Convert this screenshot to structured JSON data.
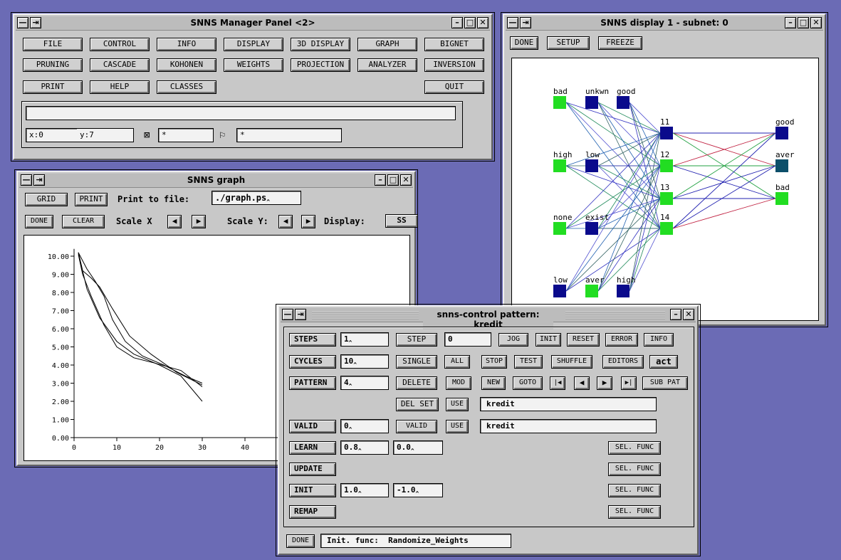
{
  "manager": {
    "title": "SNNS Manager Panel <2>",
    "row1": [
      "FILE",
      "CONTROL",
      "INFO",
      "DISPLAY",
      "3D DISPLAY",
      "GRAPH",
      "BIGNET"
    ],
    "row2": [
      "PRUNING",
      "CASCADE",
      "KOHONEN",
      "WEIGHTS",
      "PROJECTION",
      "ANALYZER",
      "INVERSION"
    ],
    "row3": [
      "PRINT",
      "HELP",
      "CLASSES"
    ],
    "quit": "QUIT",
    "message": "",
    "x_label": "x:0",
    "y_label": "y:7",
    "field1": "*",
    "field2": "*"
  },
  "display": {
    "title": "SNNS display 1 - subnet: 0",
    "buttons": [
      "DONE",
      "SETUP",
      "FREEZE"
    ],
    "unit_labels": [
      "bad",
      "unkwn",
      "good",
      "high",
      "low",
      "none",
      "exist",
      "low",
      "aver",
      "high",
      "11",
      "12",
      "13",
      "14",
      "good",
      "aver",
      "bad"
    ]
  },
  "graph": {
    "title": "SNNS graph",
    "grid": "GRID",
    "print": "PRINT",
    "print_to_file": "Print to file:",
    "file": "./graph.ps",
    "done": "DONE",
    "clear": "CLEAR",
    "scale_x": "Scale X",
    "scale_y": "Scale Y:",
    "display": "Display:",
    "ss": "SS",
    "y_ticks": [
      "10.00",
      "9.00",
      "8.00",
      "7.00",
      "6.00",
      "5.00",
      "4.00",
      "3.00",
      "2.00",
      "1.00",
      "0.00"
    ],
    "x_ticks": [
      "0",
      "10",
      "20",
      "30",
      "40"
    ]
  },
  "chart_data": {
    "type": "line",
    "title": "",
    "xlabel": "",
    "ylabel": "",
    "xlim": [
      0,
      42
    ],
    "ylim": [
      0,
      10
    ],
    "series": [
      {
        "x": [
          1,
          3,
          6,
          10,
          14,
          20,
          25,
          30
        ],
        "values": [
          10.2,
          8.2,
          6.6,
          5.3,
          4.6,
          4.0,
          3.4,
          2.0
        ]
      },
      {
        "x": [
          1,
          2,
          4,
          6,
          9,
          13,
          18,
          24,
          30
        ],
        "values": [
          10.2,
          9.2,
          8.8,
          8.3,
          7.1,
          5.6,
          4.6,
          3.6,
          2.9
        ]
      },
      {
        "x": [
          1,
          3,
          5,
          7,
          9,
          12,
          16,
          21,
          26,
          30
        ],
        "values": [
          10.2,
          9.3,
          8.6,
          7.8,
          6.5,
          5.3,
          4.5,
          4.0,
          3.4,
          3.0
        ]
      },
      {
        "x": [
          1,
          2,
          4,
          7,
          10,
          14,
          19,
          25,
          30
        ],
        "values": [
          10.1,
          9.0,
          7.8,
          6.2,
          5.0,
          4.4,
          4.1,
          3.7,
          2.8
        ]
      }
    ]
  },
  "control": {
    "title": "snns-control   pattern: kredit",
    "labels": {
      "steps": "STEPS",
      "cycles": "CYCLES",
      "pattern": "PATTERN",
      "valid": "VALID",
      "learn": "LEARN",
      "update": "UPDATE",
      "init": "INIT",
      "remap": "REMAP"
    },
    "steps_value": "1",
    "cycles_value": "10",
    "pattern_value": "4",
    "valid_value": "0",
    "learn_values": [
      "0.8",
      "0.0"
    ],
    "init_values": [
      "1.0",
      "-1.0"
    ],
    "counter": "0",
    "buttons": {
      "step": "STEP",
      "jog": "JOG",
      "init": "INIT",
      "reset": "RESET",
      "error": "ERROR",
      "info": "INFO",
      "single": "SINGLE",
      "all": "ALL",
      "stop": "STOP",
      "test": "TEST",
      "shuffle": "SHUFFLE",
      "editors": "EDITORS",
      "act": "act",
      "delete": "DELETE",
      "mod": "MOD",
      "new": "NEW",
      "goto": "GOTO",
      "first": "|◀",
      "prev": "◀",
      "next": "▶",
      "last": "▶|",
      "sub_pat": "SUB PAT",
      "del_set": "DEL SET",
      "use": "USE",
      "valid": "VALID",
      "sel_func": "SEL. FUNC",
      "done": "DONE"
    },
    "set_name": "kredit",
    "valid_set_name": "kredit",
    "init_func_label": "Init. func:",
    "init_func": "Randomize_Weights"
  }
}
